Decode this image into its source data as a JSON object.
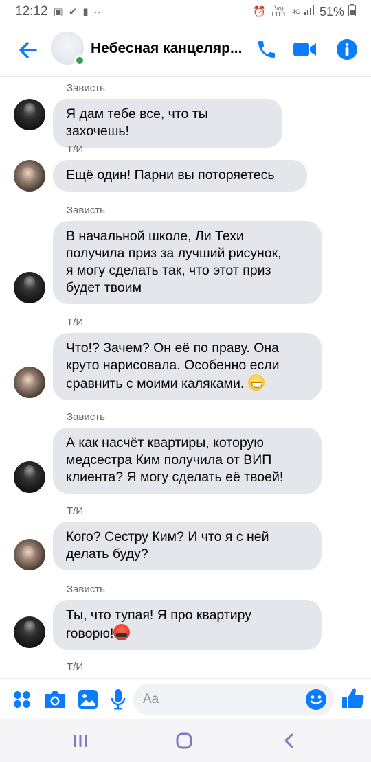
{
  "status_bar": {
    "time": "12:12",
    "signal_label": "Vo) LTE1",
    "network": "4G",
    "battery": "51%"
  },
  "header": {
    "title": "Небесная канцеляр...",
    "accent_color": "#0a7cff",
    "online_color": "#31a24c"
  },
  "messages": [
    {
      "sender": "Зависть",
      "text": "Я дам тебе все, что ты захочешь!"
    },
    {
      "sender": "Т/И",
      "text": "Ещё один! Парни вы поторяетесь"
    },
    {
      "sender": "Зависть",
      "line1": "В начальной школе, Ли Техи",
      "line2": "получила приз за лучший рисунок,",
      "line3": "я могу сделать так, что этот приз",
      "line4": "будет твоим"
    },
    {
      "sender": "Т/И",
      "line1": "Что!? Зачем? Он её по праву. Она",
      "line2": "круто нарисовала. Особенно если",
      "line3": "сравнить с моими каляками.",
      "emoji": "grinning-face-emoji"
    },
    {
      "sender": "Зависть",
      "line1": "А как насчёт квартиры, которую",
      "line2": "медсестра Ким получила от ВИП",
      "line3": "клиента? Я могу сделать её твоей!"
    },
    {
      "sender": "Т/И",
      "line1": "Кого? Сестру Ким? И что я с ней",
      "line2": "делать буду?"
    },
    {
      "sender": "Зависть",
      "line1": "Ты, что тупая! Я про квартиру",
      "line2": "говорю!",
      "emoji": "angry-face-emoji"
    },
    {
      "sender": "Т/И"
    }
  ],
  "composer": {
    "placeholder": "Aa"
  }
}
